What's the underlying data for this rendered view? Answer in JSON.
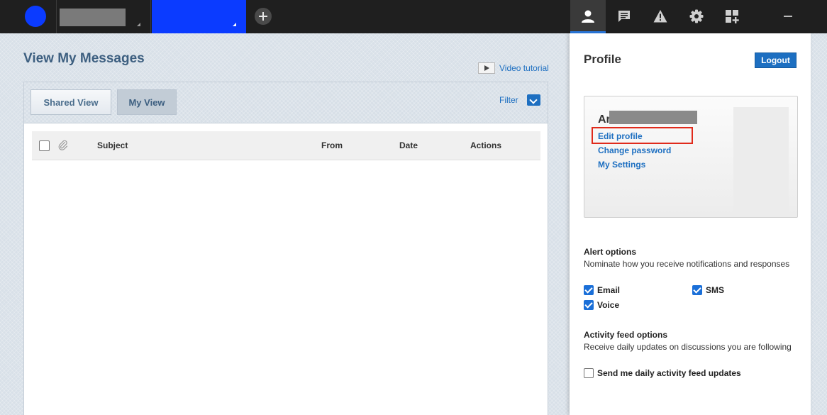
{
  "topbar": {
    "nav_icons": [
      {
        "name": "profile-icon",
        "active": true
      },
      {
        "name": "messages-icon",
        "active": false
      },
      {
        "name": "alerts-icon",
        "active": false
      },
      {
        "name": "settings-icon",
        "active": false
      },
      {
        "name": "add-widget-icon",
        "active": false
      }
    ]
  },
  "main": {
    "title": "View My Messages",
    "video_tutorial": "Video tutorial",
    "tabs": [
      {
        "label": "Shared View",
        "active": false
      },
      {
        "label": "My View",
        "active": true
      }
    ],
    "filter_label": "Filter",
    "table": {
      "columns": [
        "Subject",
        "From",
        "Date",
        "Actions"
      ],
      "rows": []
    }
  },
  "profile": {
    "title": "Profile",
    "logout_label": "Logout",
    "name_visible": "Ar",
    "links": {
      "edit_profile": "Edit profile",
      "change_password": "Change password",
      "my_settings": "My Settings"
    },
    "alert_options": {
      "title": "Alert options",
      "description": "Nominate how you receive notifications and responses",
      "email": {
        "label": "Email",
        "checked": true
      },
      "sms": {
        "label": "SMS",
        "checked": true
      },
      "voice": {
        "label": "Voice",
        "checked": true
      }
    },
    "activity_feed": {
      "title": "Activity feed options",
      "description": "Receive daily updates on discussions you are following",
      "daily_updates": {
        "label": "Send me daily activity feed updates",
        "checked": false
      }
    }
  },
  "colors": {
    "accent": "#1d6fc1",
    "brand_blue": "#0b3bff",
    "highlight": "#e02a1b",
    "topbar": "#1f1f1f"
  }
}
